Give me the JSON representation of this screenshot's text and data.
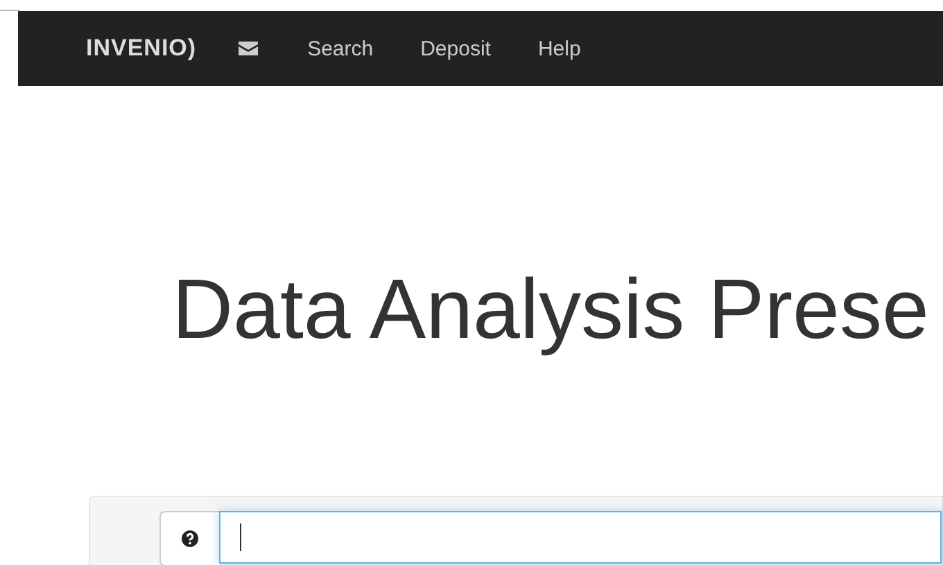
{
  "navbar": {
    "logo": "INVENIO)",
    "links": [
      {
        "label": "Search"
      },
      {
        "label": "Deposit"
      },
      {
        "label": "Help"
      }
    ]
  },
  "title": "Data Analysis Prese",
  "form": {
    "field": {
      "focused": true
    }
  }
}
